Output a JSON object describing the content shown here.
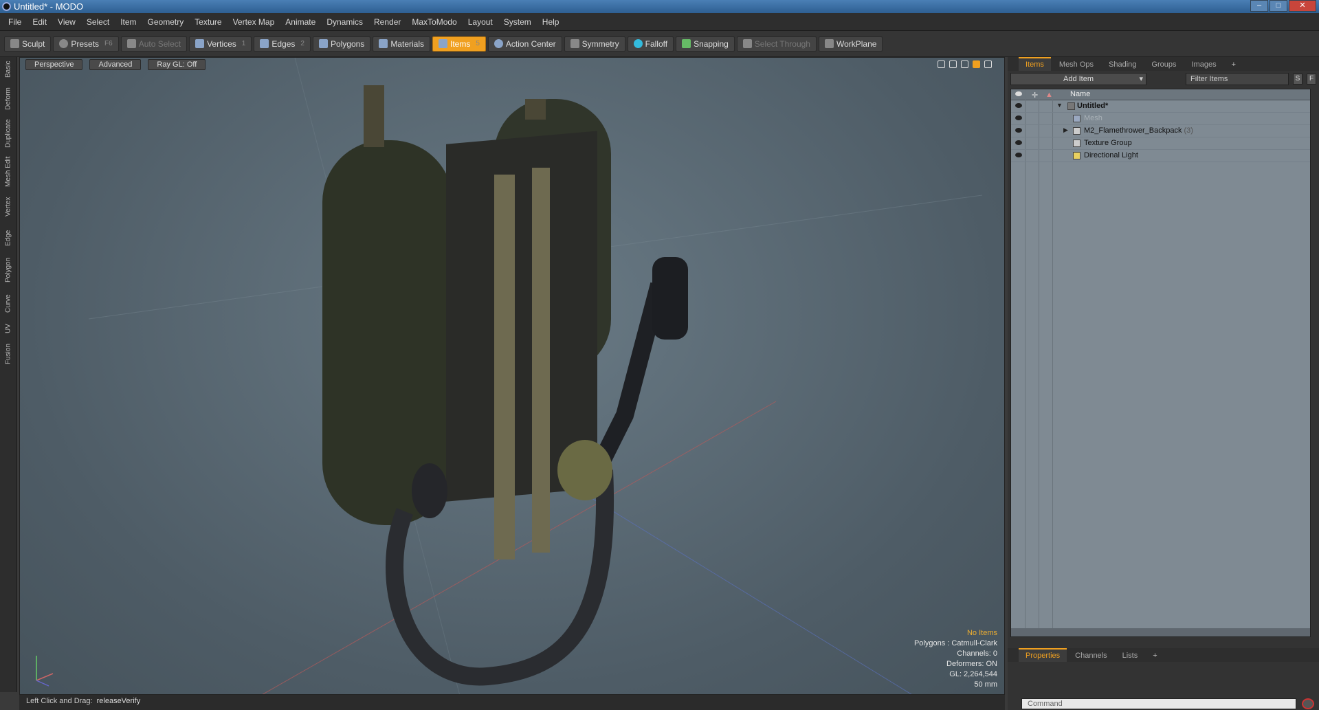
{
  "window": {
    "title": "Untitled* - MODO"
  },
  "menu": [
    "File",
    "Edit",
    "View",
    "Select",
    "Item",
    "Geometry",
    "Texture",
    "Vertex Map",
    "Animate",
    "Dynamics",
    "Render",
    "MaxToModo",
    "Layout",
    "System",
    "Help"
  ],
  "toolbar": {
    "sculpt": "Sculpt",
    "presets": "Presets",
    "presets_key": "F6",
    "auto_select": "Auto Select",
    "vertices": "Vertices",
    "vertices_key": "1",
    "edges": "Edges",
    "edges_key": "2",
    "polygons": "Polygons",
    "materials": "Materials",
    "items": "Items",
    "items_key": "5",
    "action_center": "Action Center",
    "symmetry": "Symmetry",
    "falloff": "Falloff",
    "snapping": "Snapping",
    "select_through": "Select Through",
    "workplane": "WorkPlane"
  },
  "lefttabs": [
    "Basic",
    "Deform",
    "Duplicate",
    "Mesh Edit",
    "Vertex",
    "Edge",
    "Polygon",
    "Curve",
    "UV",
    "Fusion"
  ],
  "viewport": {
    "view": "Perspective",
    "shading": "Advanced",
    "raygl": "Ray GL: Off",
    "stats": {
      "selection": "No Items",
      "polygons": "Polygons : Catmull-Clark",
      "channels": "Channels: 0",
      "deformers": "Deformers: ON",
      "gl": "GL: 2,264,544",
      "units": "50 mm"
    }
  },
  "status": {
    "hint": "Left Click and Drag:",
    "action": "releaseVerify"
  },
  "items_panel": {
    "tabs": [
      "Items",
      "Mesh Ops",
      "Shading",
      "Groups",
      "Images"
    ],
    "add_item": "Add Item",
    "filter_placeholder": "Filter Items",
    "btn_s": "S",
    "btn_f": "F",
    "column_name": "Name",
    "rows": [
      {
        "label": "Untitled*",
        "count": ""
      },
      {
        "label": "Mesh",
        "count": ""
      },
      {
        "label": "M2_Flamethrower_Backpack",
        "count": "(3)"
      },
      {
        "label": "Texture Group",
        "count": ""
      },
      {
        "label": "Directional Light",
        "count": ""
      }
    ]
  },
  "props_panel": {
    "tabs": [
      "Properties",
      "Channels",
      "Lists"
    ]
  },
  "command": {
    "placeholder": "Command"
  },
  "colors": {
    "accent": "#f0a020",
    "viewport_bg": "#5b6a74",
    "tree_bg": "#7f8a93"
  }
}
